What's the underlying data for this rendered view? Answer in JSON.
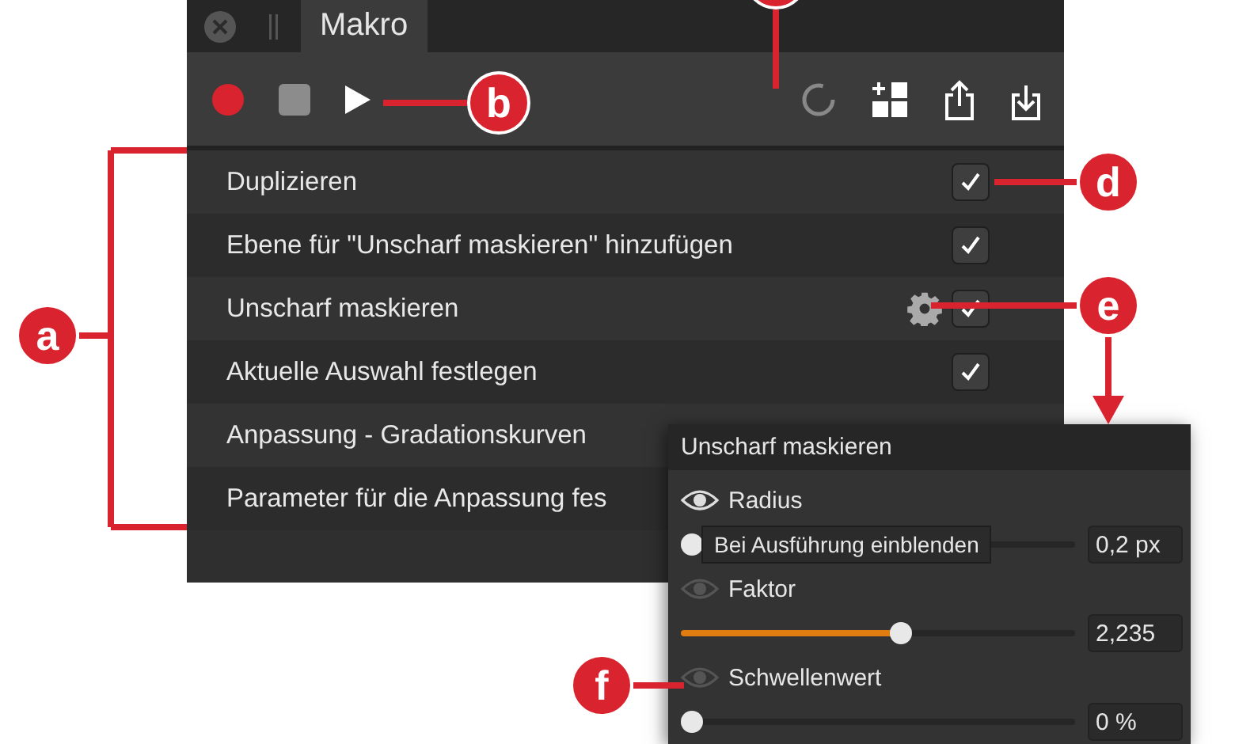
{
  "tab": {
    "title": "Makro",
    "selected": true
  },
  "steps": [
    {
      "label": "Duplizieren",
      "checked": true,
      "settings": false
    },
    {
      "label": "Ebene für \"Unscharf maskieren\" hinzufügen",
      "checked": true,
      "settings": false
    },
    {
      "label": "Unscharf maskieren",
      "checked": true,
      "settings": true
    },
    {
      "label": "Aktuelle Auswahl festlegen",
      "checked": true,
      "settings": false
    },
    {
      "label": "Anpassung - Gradationskurven",
      "settings": false
    },
    {
      "label": "Parameter für die Anpassung fes",
      "settings": false
    }
  ],
  "popup": {
    "title": "Unscharf maskieren",
    "tooltip": "Bei Ausführung einblenden",
    "params": [
      {
        "label": "Radius",
        "visible": true,
        "level": 0,
        "value": "0,2 px"
      },
      {
        "label": "Faktor",
        "visible": false,
        "level": 0.56,
        "value": "2,235"
      },
      {
        "label": "Schwellenwert",
        "visible": false,
        "level": 0,
        "value": "0 %"
      }
    ]
  },
  "callouts": [
    {
      "kind": "full",
      "label": "a"
    },
    {
      "kind": "full",
      "label": "b"
    },
    {
      "kind": "cut"
    },
    {
      "kind": "full",
      "label": "d"
    },
    {
      "kind": "full",
      "label": "e"
    },
    {
      "kind": "full",
      "label": "f"
    }
  ]
}
